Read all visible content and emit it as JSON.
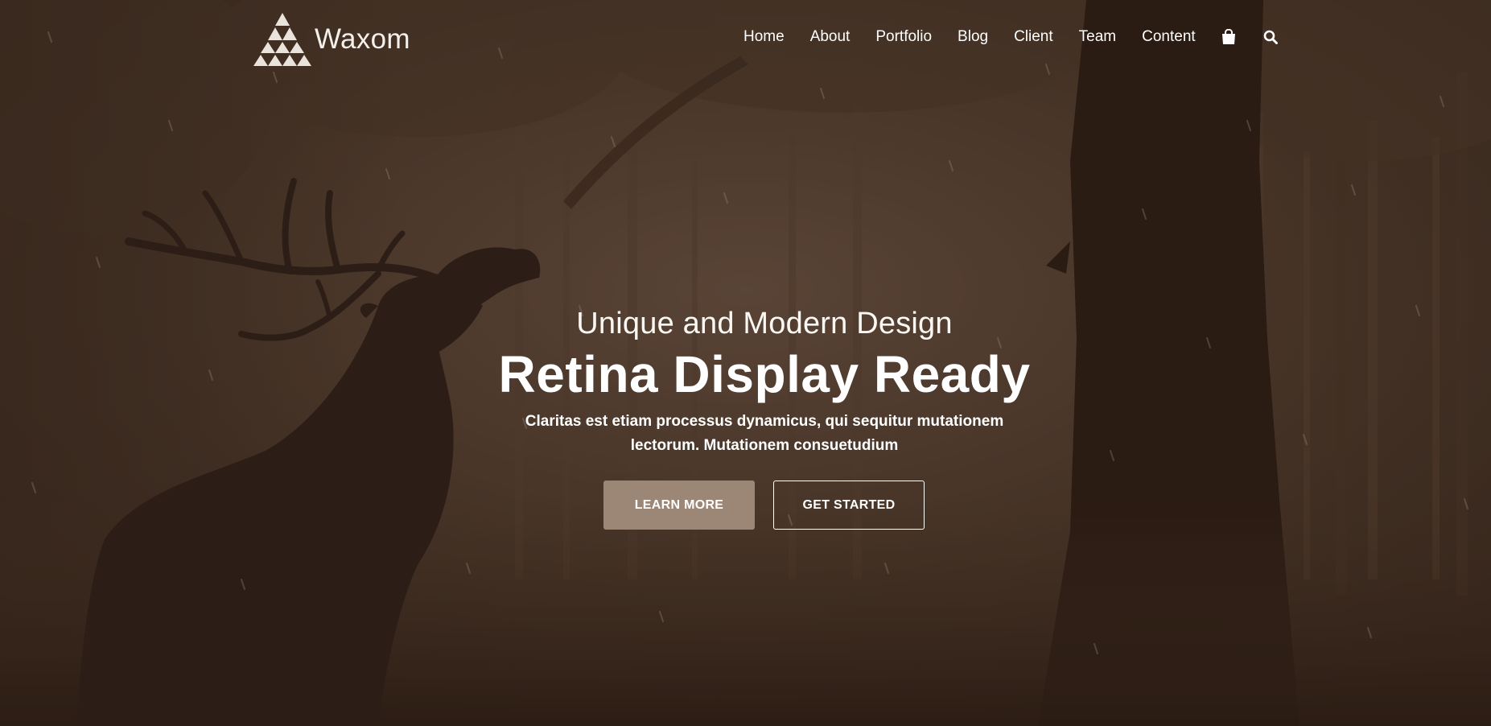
{
  "brand": {
    "name": "Waxom",
    "logo_icon": "triangle-logo-icon"
  },
  "nav": {
    "items": [
      {
        "label": "Home"
      },
      {
        "label": "About"
      },
      {
        "label": "Portfolio"
      },
      {
        "label": "Blog"
      },
      {
        "label": "Client"
      },
      {
        "label": "Team"
      },
      {
        "label": "Content"
      }
    ],
    "cart_icon": "shopping-bag-icon",
    "search_icon": "search-icon"
  },
  "hero": {
    "subtitle": "Unique and Modern Design",
    "title": "Retina Display Ready",
    "description": "Claritas est etiam processus dynamicus, qui sequitur mutationem lectorum. Mutationem consuetudium",
    "buttons": {
      "learn_more": "LEARN MORE",
      "get_started": "GET STARTED"
    }
  },
  "colors": {
    "accent": "#9c8675",
    "background": "#3a2a1e",
    "text": "#ffffff"
  }
}
